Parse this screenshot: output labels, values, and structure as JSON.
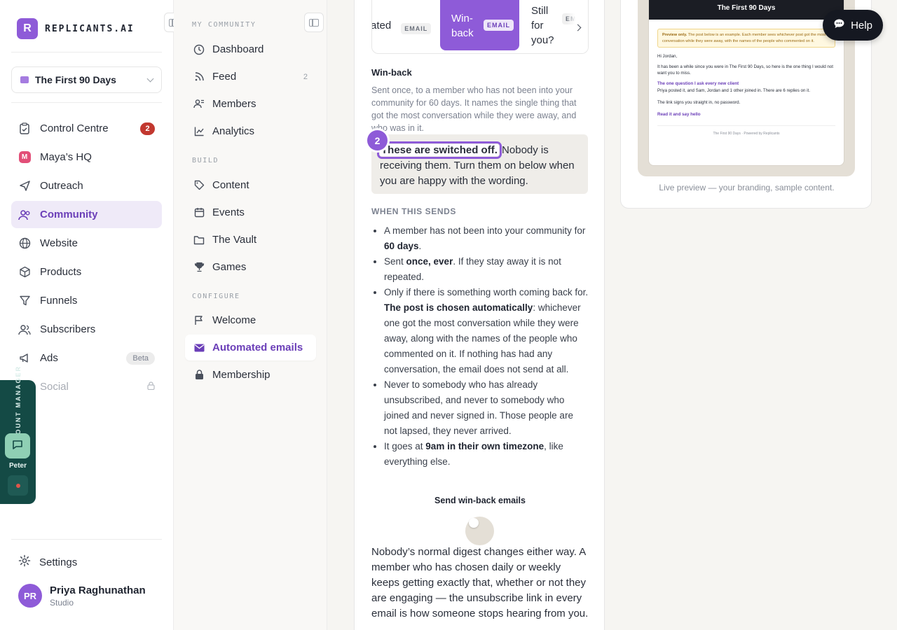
{
  "app": {
    "brand_initial": "R",
    "brand_name": "REPLICANTS.AI",
    "community_name": "The First 90 Days"
  },
  "main_nav": [
    {
      "label": "Control Centre",
      "icon": "clipboard-icon",
      "badge": "2"
    },
    {
      "label": "Maya’s HQ",
      "icon": "maya-logo-icon"
    },
    {
      "label": "Outreach",
      "icon": "send-icon"
    },
    {
      "label": "Community",
      "icon": "people-icon",
      "active": true
    },
    {
      "label": "Website",
      "icon": "globe-icon"
    },
    {
      "label": "Products",
      "icon": "box-icon"
    },
    {
      "label": "Funnels",
      "icon": "funnel-icon"
    },
    {
      "label": "Subscribers",
      "icon": "users-icon"
    },
    {
      "label": "Ads",
      "icon": "megaphone-icon",
      "badge": "Beta"
    },
    {
      "label": "Social",
      "icon": "share-icon",
      "locked": true
    }
  ],
  "footer": {
    "settings_label": "Settings",
    "user_initials": "PR",
    "user_name": "Priya Raghunathan",
    "user_plan": "Studio"
  },
  "account_manager": {
    "title": "ACCOUNT MANAGER",
    "name": "Peter"
  },
  "sub_nav": {
    "section_community": "MY COMMUNITY",
    "section_build": "BUILD",
    "section_configure": "CONFIGURE",
    "community_items": [
      {
        "label": "Dashboard",
        "icon": "clock-icon"
      },
      {
        "label": "Feed",
        "icon": "rss-icon",
        "count": "2"
      },
      {
        "label": "Members",
        "icon": "members-icon"
      },
      {
        "label": "Analytics",
        "icon": "chart-icon"
      }
    ],
    "build_items": [
      {
        "label": "Content",
        "icon": "tag-icon"
      },
      {
        "label": "Events",
        "icon": "calendar-icon"
      },
      {
        "label": "The Vault",
        "icon": "folder-icon"
      },
      {
        "label": "Games",
        "icon": "trophy-icon"
      }
    ],
    "configure_items": [
      {
        "label": "Welcome",
        "icon": "flag-icon"
      },
      {
        "label": "Automated emails",
        "icon": "envelope-icon",
        "active": true
      },
      {
        "label": "Membership",
        "icon": "lock-icon"
      }
    ]
  },
  "email_tabs": [
    {
      "label": "ated",
      "pill": "EMAIL"
    },
    {
      "label": "Win-back",
      "pill": "EMAIL",
      "active": true
    },
    {
      "label": "Still for you?",
      "pill": "EMAIL"
    }
  ],
  "editor": {
    "title": "Win-back",
    "description": "Sent once, to a member who has not been into your community for 60 days. It names the single thing that got the most conversation while they were away, and who was in it.",
    "step_number": "2",
    "off_strong": "These are switched off.",
    "off_rest": " Nobody is receiving them. Turn them on below when you are happy with the wording.",
    "when_heading": "WHEN THIS SENDS",
    "rules": [
      {
        "pre": "A member has not been into your community for ",
        "bold": "60 days",
        "post": "."
      },
      {
        "pre": "Sent ",
        "bold": "once, ever",
        "post": ". If they stay away it is not repeated."
      },
      {
        "pre": "Only if there is something worth coming back for. ",
        "bold": "The post is chosen automatically",
        "post": ": whichever one got the most conversation while they were away, along with the names of the people who commented on it. If nothing has had any conversation, the email does not send at all."
      },
      {
        "pre": "Never to somebody who has already unsubscribed, and never to somebody who joined and never signed in. Those people are not lapsed, they never arrived.",
        "bold": "",
        "post": ""
      },
      {
        "pre": "It goes at ",
        "bold": "9am in their own timezone",
        "post": ", like everything else."
      }
    ],
    "toggle_label": "Send win-back emails",
    "toggle_on": false,
    "digest_note": "Nobody’s normal digest changes either way. A member who has chosen daily or weekly keeps getting exactly that, whether or not they are engaging — the unsubscribe link in every email is how someone stops hearing from you."
  },
  "preview": {
    "header_title": "The First 90 Days",
    "note_bold": "Preview only.",
    "note_text": " The post below is an example. Each member sees whichever post got the most conversation while they were away, with the names of the people who commented on it.",
    "greeting": "Hi Jordan,",
    "intro": "It has been a while since you were in The First 90 Days, so here is the one thing I would not want you to miss.",
    "post_title": "The one question I ask every new client",
    "post_meta": "Priya posted it, and Sam, Jordan and 1 other joined in. There are 6 replies on it.",
    "signin_note": "The link signs you straight in, no password.",
    "cta": "Read it and say hello",
    "footer_left": "The First 90 Days",
    "footer_right": "Powered by Replicants",
    "caption": "Live preview — your branding, sample content."
  },
  "help": {
    "label": "Help"
  },
  "colors": {
    "accent": "#8e5bd8",
    "alert": "#c2382f",
    "manager_bg": "#144a45"
  }
}
